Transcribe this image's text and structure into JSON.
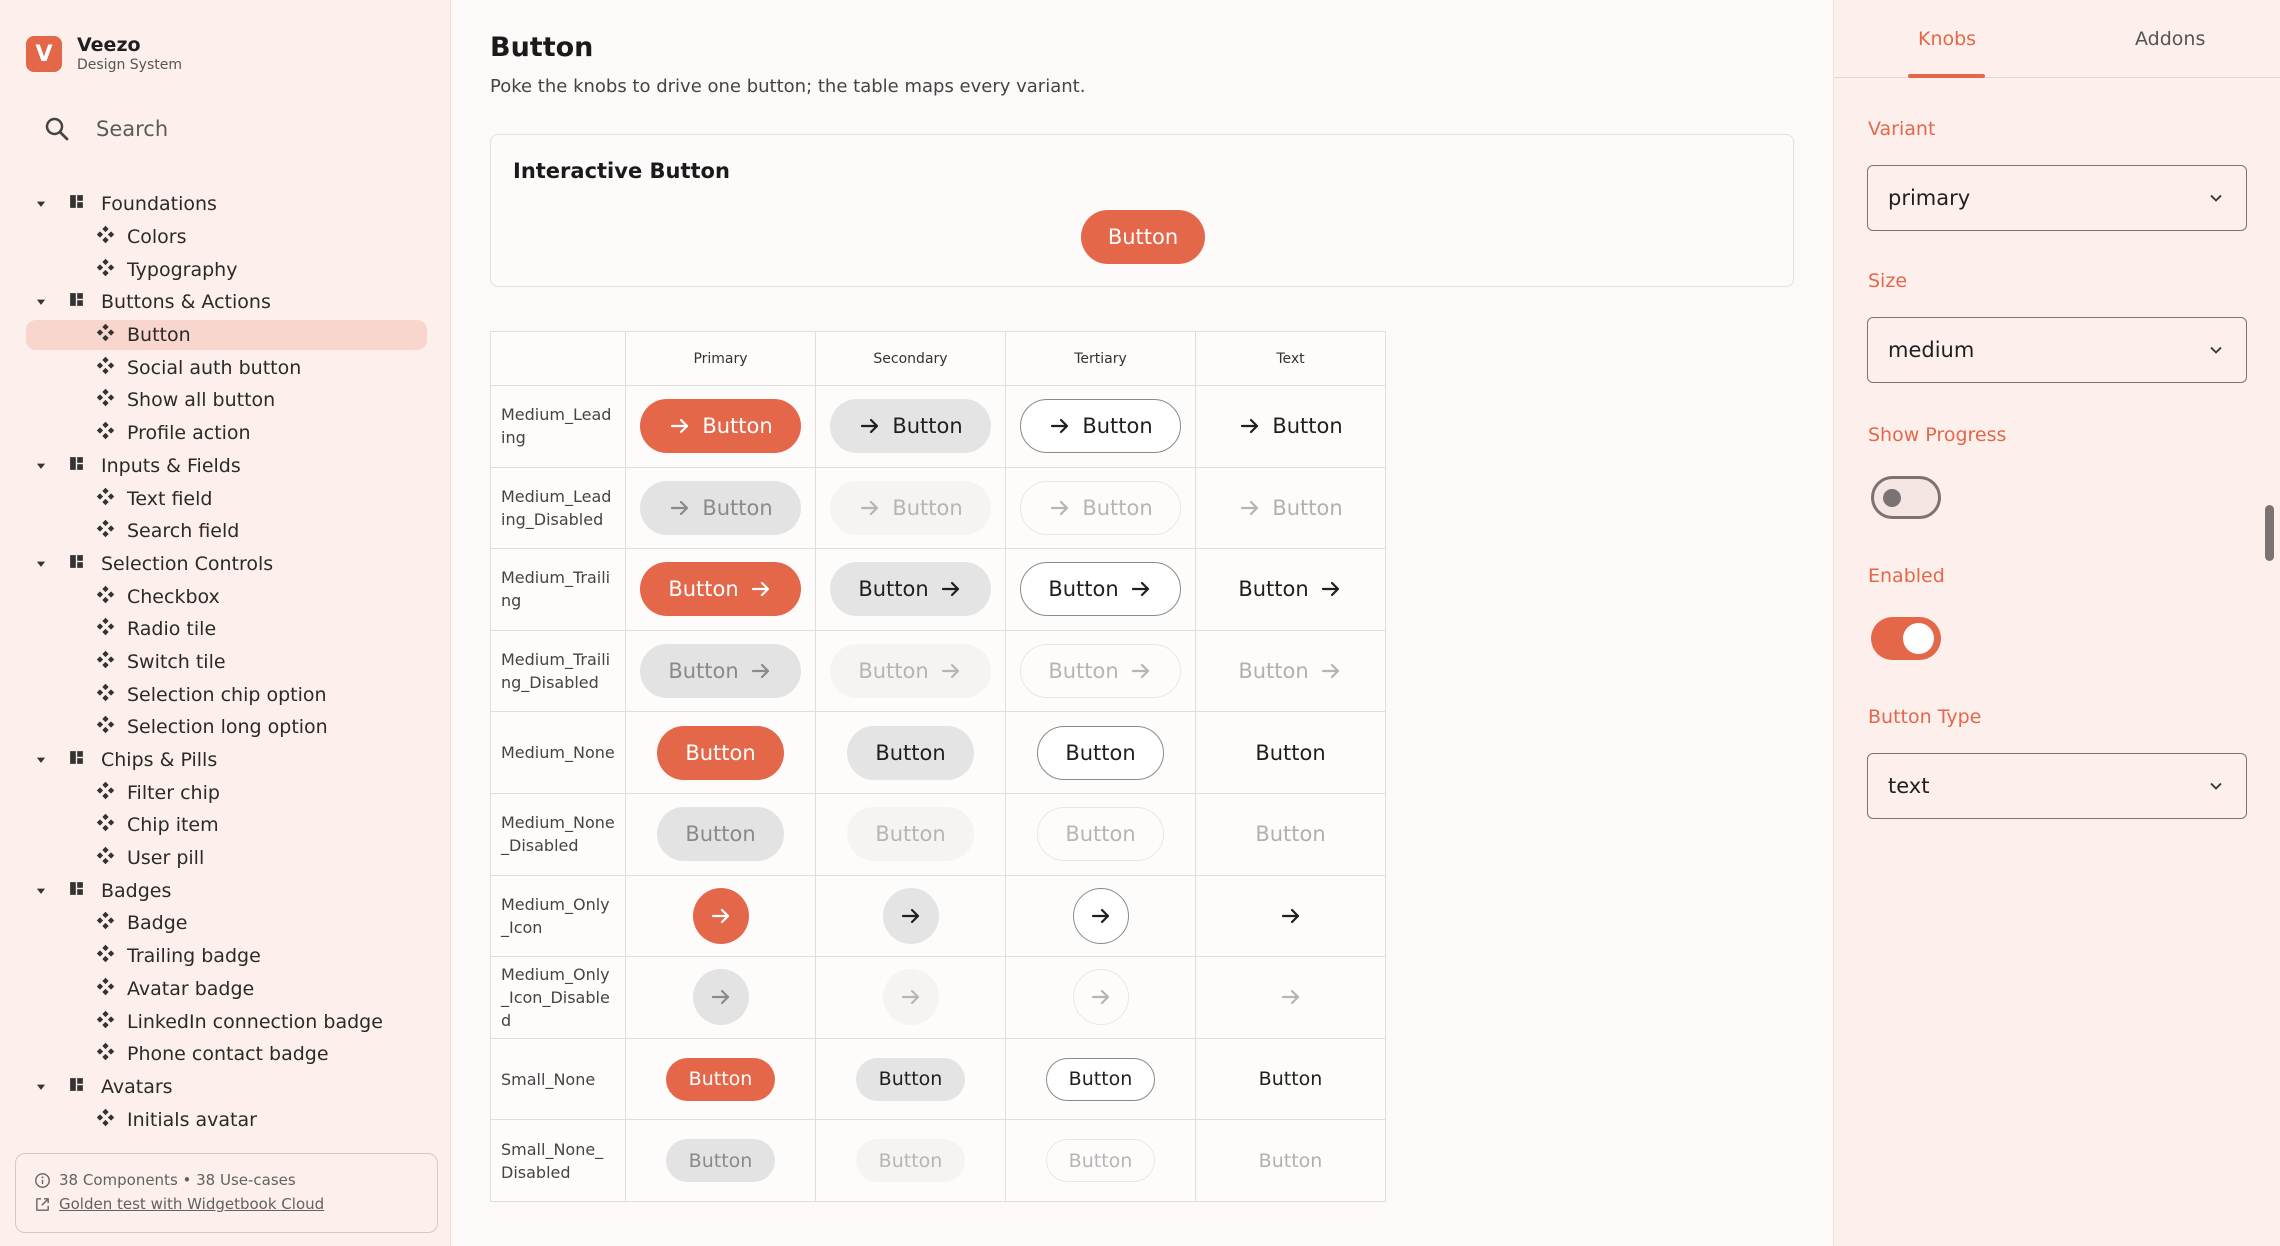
{
  "brand": {
    "logo_letter": "V",
    "name": "Veezo",
    "subtitle": "Design System"
  },
  "search": {
    "placeholder": "Search"
  },
  "nav": [
    {
      "type": "group",
      "label": "Foundations"
    },
    {
      "type": "item",
      "label": "Colors"
    },
    {
      "type": "item",
      "label": "Typography"
    },
    {
      "type": "group",
      "label": "Buttons & Actions"
    },
    {
      "type": "item",
      "label": "Button",
      "selected": true
    },
    {
      "type": "item",
      "label": "Social auth button"
    },
    {
      "type": "item",
      "label": "Show all button"
    },
    {
      "type": "item",
      "label": "Profile action"
    },
    {
      "type": "group",
      "label": "Inputs & Fields"
    },
    {
      "type": "item",
      "label": "Text field"
    },
    {
      "type": "item",
      "label": "Search field"
    },
    {
      "type": "group",
      "label": "Selection Controls"
    },
    {
      "type": "item",
      "label": "Checkbox"
    },
    {
      "type": "item",
      "label": "Radio tile"
    },
    {
      "type": "item",
      "label": "Switch tile"
    },
    {
      "type": "item",
      "label": "Selection chip option"
    },
    {
      "type": "item",
      "label": "Selection long option"
    },
    {
      "type": "group",
      "label": "Chips & Pills"
    },
    {
      "type": "item",
      "label": "Filter chip"
    },
    {
      "type": "item",
      "label": "Chip item"
    },
    {
      "type": "item",
      "label": "User pill"
    },
    {
      "type": "group",
      "label": "Badges"
    },
    {
      "type": "item",
      "label": "Badge"
    },
    {
      "type": "item",
      "label": "Trailing badge"
    },
    {
      "type": "item",
      "label": "Avatar badge"
    },
    {
      "type": "item",
      "label": "LinkedIn connection badge"
    },
    {
      "type": "item",
      "label": "Phone contact badge"
    },
    {
      "type": "group",
      "label": "Avatars"
    },
    {
      "type": "item",
      "label": "Initials avatar"
    }
  ],
  "footer": {
    "stats": "38 Components • 38 Use-cases",
    "link": "Golden test with Widgetbook Cloud"
  },
  "main": {
    "title": "Button",
    "description": "Poke the knobs to drive one button; the table maps every variant.",
    "interactive_card": {
      "title": "Interactive Button",
      "button_label": "Button"
    }
  },
  "variant_table": {
    "columns": [
      "Primary",
      "Secondary",
      "Tertiary",
      "Text"
    ],
    "column_keys": [
      "primary",
      "secondary",
      "tertiary",
      "text"
    ],
    "button_label": "Button",
    "rows": [
      {
        "label": "Medium_Leading",
        "size": "m",
        "icon": "leading",
        "disabled": false
      },
      {
        "label": "Medium_Leading_Disabled",
        "size": "m",
        "icon": "leading",
        "disabled": true
      },
      {
        "label": "Medium_Trailing",
        "size": "m",
        "icon": "trailing",
        "disabled": false
      },
      {
        "label": "Medium_Trailing_Disabled",
        "size": "m",
        "icon": "trailing",
        "disabled": true
      },
      {
        "label": "Medium_None",
        "size": "m",
        "icon": "none",
        "disabled": false
      },
      {
        "label": "Medium_None_Disabled",
        "size": "m",
        "icon": "none",
        "disabled": true
      },
      {
        "label": "Medium_Only_Icon",
        "size": "m",
        "icon": "only",
        "disabled": false
      },
      {
        "label": "Medium_Only_Icon_Disabled",
        "size": "m",
        "icon": "only",
        "disabled": true
      },
      {
        "label": "Small_None",
        "size": "s",
        "icon": "none",
        "disabled": false
      },
      {
        "label": "Small_None_Disabled",
        "size": "s",
        "icon": "none",
        "disabled": true
      }
    ]
  },
  "panel": {
    "tabs": {
      "knobs": "Knobs",
      "addons": "Addons",
      "active": "knobs"
    },
    "knobs": {
      "variant": {
        "label": "Variant",
        "value": "primary"
      },
      "size": {
        "label": "Size",
        "value": "medium"
      },
      "show_progress": {
        "label": "Show Progress",
        "value": false
      },
      "enabled": {
        "label": "Enabled",
        "value": true
      },
      "button_type": {
        "label": "Button Type",
        "value": "text"
      }
    }
  },
  "colors": {
    "accent": "#e5674a",
    "sidebar_bg": "#fdefeb",
    "selected_bg": "#f8d6cd"
  },
  "icons": {
    "search": "search-icon",
    "caret": "caret-down-icon",
    "group": "dashboard-icon",
    "item": "component-diamond-icon",
    "arrow": "arrow-right-icon",
    "info": "info-icon",
    "external": "external-link-icon",
    "dropdown": "chevron-down-icon"
  }
}
